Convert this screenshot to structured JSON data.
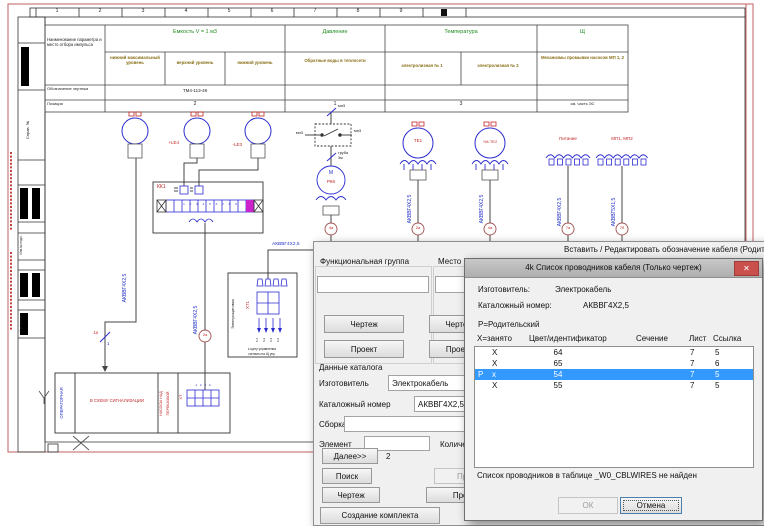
{
  "drawing": {
    "ruler": [
      "1",
      "2",
      "3",
      "4",
      "5",
      "6",
      "7",
      "8",
      "9"
    ],
    "frame": {
      "label_sprav": "Справ. №",
      "label_inv1": "Инв.№ подл.",
      "label_inv2": "Инв.№ подл."
    },
    "table": {
      "param_header": "Наименование параметра и место отбора импульса",
      "group_capacity": "Емкость V = 1 м3",
      "group_pressure": "Давление",
      "group_temperature": "Температура",
      "group_shield": "Щ",
      "sub_low_max": "нижний максимальный уровень",
      "sub_upper": "верхний уровень",
      "sub_lower": "нижний уровень",
      "sub_return_water": "Обратные воды в теплосети",
      "sub_electro1": "электролизная № 1",
      "sub_electro2": "электролизная № 2",
      "sub_pumps": "Механизмы промывки насосов МП 1, 2",
      "row_designation_label": "Обозначение чертежа",
      "row_designation_value": "ТМ4-113-49",
      "row_position_label": "Позиция",
      "pos_capacity": "2",
      "pos_pressure": "1",
      "pos_temperature": "3",
      "pos_shield": "см. часть ЭС"
    },
    "schematic": {
      "cable": "АКВВГ4Х2,5",
      "cable2": "АКВВГ5Х1,5",
      "kk1": "КК1",
      "kk1_numbers": "1 2 3 4 5 6 7 8 9",
      "le4": "+LE4",
      "le3": "-LE3",
      "motor": "М",
      "rk6": "РК6",
      "mp3": "мп3",
      "truba": "труба",
      "truba2": "3м",
      "te1": "ТЕ1",
      "te2": "+М-ТЕ2",
      "power": "Питание",
      "mp12": "МП1, МП2",
      "balloons": [
        "2а",
        "4а",
        "2а",
        "4а",
        "7а",
        "7б"
      ],
      "slash_label": "1а",
      "slash_num": "1",
      "operator_room": "ОПЕРАТОРНАЯ",
      "to_alarm": "В СХЕМУ СИГНАЛИЗАЦИИ",
      "pumps_line1": "НАСОСЫ НАД",
      "pumps_line2": "ПЕРЕКАЧКОЙ",
      "xt": "ХТ",
      "xt_numbers": "1 2 3 4",
      "xt1": "ХТ1",
      "switchroom": "Электрощитовая",
      "arrow_labels": [
        "6-1",
        "6-2",
        "6-4",
        "6-3"
      ],
      "to_panel": "к щиту управления",
      "to_panel2": "сигналы на Щ упр."
    }
  },
  "back_dialog": {
    "title": "Вставить / Редактировать обозначение кабеля (Родительский компонент)",
    "functional_group_label": "Функциональная группа",
    "location_label": "Место",
    "drawing_button": "Чертеж",
    "project_button": "Проект",
    "catalog_section_label": "Данные каталога",
    "manufacturer_label": "Изготовитель",
    "manufacturer_value": "Электрокабель",
    "catalog_number_label": "Каталожный номер",
    "catalog_number_value": "АКВВГ4Х2,5",
    "assembly_label": "Сборка",
    "element_label": "Элемент",
    "count_label": "Количество",
    "next_button": "Далее>>",
    "next_count": "2",
    "search_button": "Поиск",
    "previous_button": "Предыдущее",
    "create_set_button": "Создание комплекта"
  },
  "front_dialog": {
    "title": "4k Список проводников кабеля  (Только чертеж)",
    "close_glyph": "✕",
    "manufacturer_label": "Изготовитель:",
    "manufacturer_value": "Электрокабель",
    "catalog_number_label": "Каталожный номер:",
    "catalog_number_value": "АКВВГ4Х2,5",
    "parent_label": "Р=Родительский",
    "columns": [
      "Х=занято",
      "Цвет/идентификатор",
      "Сечение",
      "Лист",
      "Ссылка"
    ],
    "rows": [
      {
        "p": "",
        "x": "X",
        "color": "64",
        "sheet": "7",
        "ref": "5"
      },
      {
        "p": "",
        "x": "X",
        "color": "65",
        "sheet": "7",
        "ref": "6"
      },
      {
        "p": "Р",
        "x": "x",
        "color": "54",
        "sheet": "7",
        "ref": "5"
      },
      {
        "p": "",
        "x": "X",
        "color": "55",
        "sheet": "7",
        "ref": "5"
      }
    ],
    "status_text": "Список проводников в таблице _W0_CBLWIRES не найден",
    "ok_button": "ОК",
    "cancel_button": "Отмена"
  }
}
